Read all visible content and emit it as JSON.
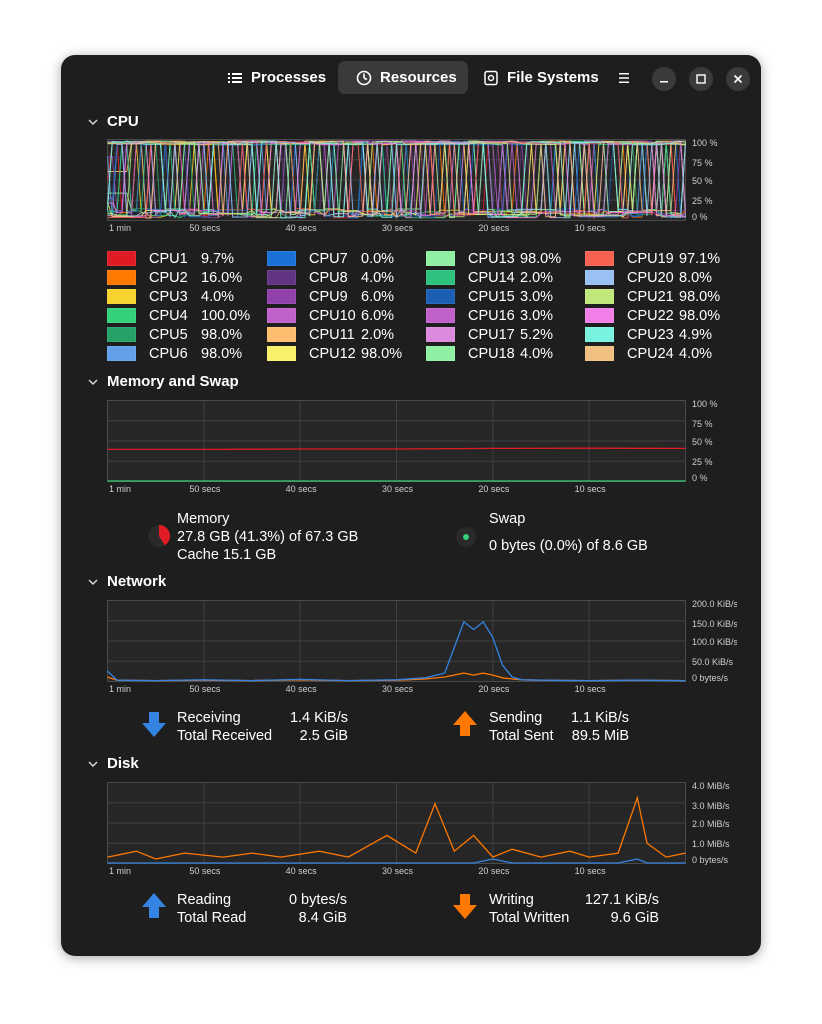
{
  "tabs": [
    {
      "label": "Processes",
      "icon": "list-icon"
    },
    {
      "label": "Resources",
      "icon": "gauge-icon"
    },
    {
      "label": "File Systems",
      "icon": "disk-icon"
    }
  ],
  "active_tab": "Resources",
  "sections": {
    "cpu": {
      "title": "CPU"
    },
    "memory": {
      "title": "Memory and Swap"
    },
    "network": {
      "title": "Network"
    },
    "disk": {
      "title": "Disk"
    }
  },
  "time_ticks": [
    "1 min",
    "50 secs",
    "40 secs",
    "30 secs",
    "20 secs",
    "10 secs"
  ],
  "cpu_axis": [
    "100 %",
    "75 %",
    "50 %",
    "25 %",
    "0 %"
  ],
  "mem_axis": [
    "100 %",
    "75 %",
    "50 %",
    "25 %",
    "0 %"
  ],
  "net_axis": [
    "200.0 KiB/s",
    "150.0 KiB/s",
    "100.0 KiB/s",
    "50.0 KiB/s",
    "0 bytes/s"
  ],
  "disk_axis": [
    "4.0 MiB/s",
    "3.0 MiB/s",
    "2.0 MiB/s",
    "1.0 MiB/s",
    "0 bytes/s"
  ],
  "cpus": [
    {
      "name": "CPU1",
      "value": "9.7%",
      "color": "#e01b24"
    },
    {
      "name": "CPU2",
      "value": "16.0%",
      "color": "#ff7800"
    },
    {
      "name": "CPU3",
      "value": "4.0%",
      "color": "#f6d32d"
    },
    {
      "name": "CPU4",
      "value": "100.0%",
      "color": "#33d17a"
    },
    {
      "name": "CPU5",
      "value": "98.0%",
      "color": "#26a269"
    },
    {
      "name": "CPU6",
      "value": "98.0%",
      "color": "#62a0ea"
    },
    {
      "name": "CPU7",
      "value": "0.0%",
      "color": "#1c71d8"
    },
    {
      "name": "CPU8",
      "value": "4.0%",
      "color": "#613583"
    },
    {
      "name": "CPU9",
      "value": "6.0%",
      "color": "#9141ac"
    },
    {
      "name": "CPU10",
      "value": "6.0%",
      "color": "#c061cb"
    },
    {
      "name": "CPU11",
      "value": "2.0%",
      "color": "#ffbe6f"
    },
    {
      "name": "CPU12",
      "value": "98.0%",
      "color": "#f9f06b"
    },
    {
      "name": "CPU13",
      "value": "98.0%",
      "color": "#8ff0a4"
    },
    {
      "name": "CPU14",
      "value": "2.0%",
      "color": "#2ec27e"
    },
    {
      "name": "CPU15",
      "value": "3.0%",
      "color": "#1a5fb4"
    },
    {
      "name": "CPU16",
      "value": "3.0%",
      "color": "#c061cb"
    },
    {
      "name": "CPU17",
      "value": "5.2%",
      "color": "#dc8add"
    },
    {
      "name": "CPU18",
      "value": "4.0%",
      "color": "#8ff0a4"
    },
    {
      "name": "CPU19",
      "value": "97.1%",
      "color": "#f66151"
    },
    {
      "name": "CPU20",
      "value": "8.0%",
      "color": "#99c1f1"
    },
    {
      "name": "CPU21",
      "value": "98.0%",
      "color": "#c0e87a"
    },
    {
      "name": "CPU22",
      "value": "98.0%",
      "color": "#f080e8"
    },
    {
      "name": "CPU23",
      "value": "4.9%",
      "color": "#79f2e0"
    },
    {
      "name": "CPU24",
      "value": "4.0%",
      "color": "#f0c080"
    }
  ],
  "memory": {
    "label": "Memory",
    "usage": "27.8 GB (41.3%) of 67.3 GB",
    "cache": "Cache 15.1 GB",
    "fraction": 0.413,
    "color": "#e01b24"
  },
  "swap": {
    "label": "Swap",
    "usage": "0 bytes (0.0%) of 8.6 GB",
    "fraction": 0.0,
    "color": "#33d17a"
  },
  "network": {
    "receiving_label": "Receiving",
    "receiving_value": "1.4 KiB/s",
    "total_received_label": "Total Received",
    "total_received_value": "2.5 GiB",
    "sending_label": "Sending",
    "sending_value": "1.1 KiB/s",
    "total_sent_label": "Total Sent",
    "total_sent_value": "89.5 MiB",
    "receive_color": "#3584e4",
    "send_color": "#ff7800"
  },
  "disk": {
    "reading_label": "Reading",
    "reading_value": "0 bytes/s",
    "total_read_label": "Total Read",
    "total_read_value": "8.4 GiB",
    "writing_label": "Writing",
    "writing_value": "127.1 KiB/s",
    "total_written_label": "Total Written",
    "total_written_value": "9.6 GiB",
    "read_color": "#3584e4",
    "write_color": "#ff7800"
  },
  "chart_data": [
    {
      "type": "line",
      "title": "Memory and Swap",
      "x": [
        60,
        50,
        40,
        30,
        20,
        10,
        0
      ],
      "series": [
        {
          "name": "Memory",
          "values": [
            40,
            40,
            40.5,
            40.5,
            41.3,
            41.5,
            41.3
          ]
        },
        {
          "name": "Swap",
          "values": [
            0,
            0,
            0,
            0,
            0,
            0,
            0
          ]
        }
      ],
      "ylim": [
        0,
        100
      ]
    },
    {
      "type": "line",
      "title": "Network",
      "x": [
        60,
        59,
        55,
        50,
        45,
        40,
        35,
        30,
        27,
        25,
        23,
        22,
        21,
        20,
        19,
        18,
        17,
        15,
        10,
        5,
        0
      ],
      "series": [
        {
          "name": "Receiving",
          "values": [
            25,
            2,
            1,
            3,
            1,
            4,
            1,
            3,
            8,
            20,
            150,
            130,
            150,
            110,
            40,
            10,
            3,
            2,
            1,
            2,
            1
          ]
        },
        {
          "name": "Sending",
          "values": [
            10,
            2,
            1,
            2,
            1,
            3,
            1,
            2,
            5,
            10,
            20,
            15,
            20,
            15,
            8,
            5,
            3,
            2,
            1,
            2,
            1
          ]
        }
      ],
      "ylim": [
        0,
        200
      ]
    },
    {
      "type": "line",
      "title": "Disk",
      "x": [
        60,
        57,
        55,
        52,
        48,
        45,
        42,
        38,
        35,
        31,
        28,
        26,
        24,
        22,
        20,
        18,
        15,
        12,
        10,
        7,
        5,
        4,
        2,
        0
      ],
      "series": [
        {
          "name": "Reading",
          "values": [
            0,
            0,
            0,
            0,
            0,
            0,
            0,
            0,
            0,
            0,
            0,
            0,
            0,
            0,
            0.2,
            0,
            0,
            0,
            0,
            0,
            0.2,
            0,
            0,
            0
          ]
        },
        {
          "name": "Writing",
          "values": [
            0.3,
            0.6,
            0.2,
            0.5,
            0.3,
            0.5,
            0.3,
            0.6,
            0.3,
            1.4,
            0.5,
            3.0,
            0.6,
            1.4,
            0.3,
            0.7,
            0.3,
            0.6,
            0.3,
            0.5,
            3.3,
            1.0,
            0.3,
            0.5
          ]
        }
      ],
      "ylim": [
        0,
        4
      ]
    }
  ]
}
